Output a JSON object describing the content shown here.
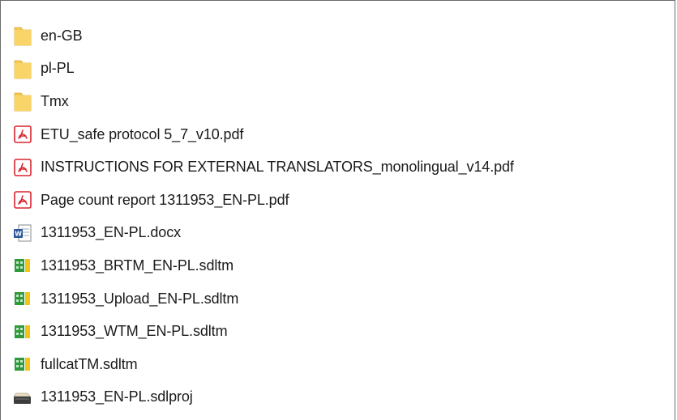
{
  "explorer": {
    "items": [
      {
        "name": "en-GB",
        "icon": "folder-icon"
      },
      {
        "name": "pl-PL",
        "icon": "folder-icon"
      },
      {
        "name": "Tmx",
        "icon": "folder-icon"
      },
      {
        "name": "ETU_safe protocol 5_7_v10.pdf",
        "icon": "pdf-icon"
      },
      {
        "name": "INSTRUCTIONS FOR EXTERNAL TRANSLATORS_monolingual_v14.pdf",
        "icon": "pdf-icon"
      },
      {
        "name": "Page count report 1311953_EN-PL.pdf",
        "icon": "pdf-icon"
      },
      {
        "name": "1311953_EN-PL.docx",
        "icon": "word-doc-icon"
      },
      {
        "name": "1311953_BRTM_EN-PL.sdltm",
        "icon": "sdltm-icon"
      },
      {
        "name": "1311953_Upload_EN-PL.sdltm",
        "icon": "sdltm-icon"
      },
      {
        "name": "1311953_WTM_EN-PL.sdltm",
        "icon": "sdltm-icon"
      },
      {
        "name": "fullcatTM.sdltm",
        "icon": "sdltm-icon"
      },
      {
        "name": "1311953_EN-PL.sdlproj",
        "icon": "sdlproj-icon"
      }
    ]
  },
  "colors": {
    "folder": "#f5c94d",
    "pdf": "#d9232e",
    "word": "#2b579a",
    "sdltm_green": "#2e9a3c",
    "sdltm_yellow": "#f2c318",
    "text": "#1a1a1a"
  }
}
